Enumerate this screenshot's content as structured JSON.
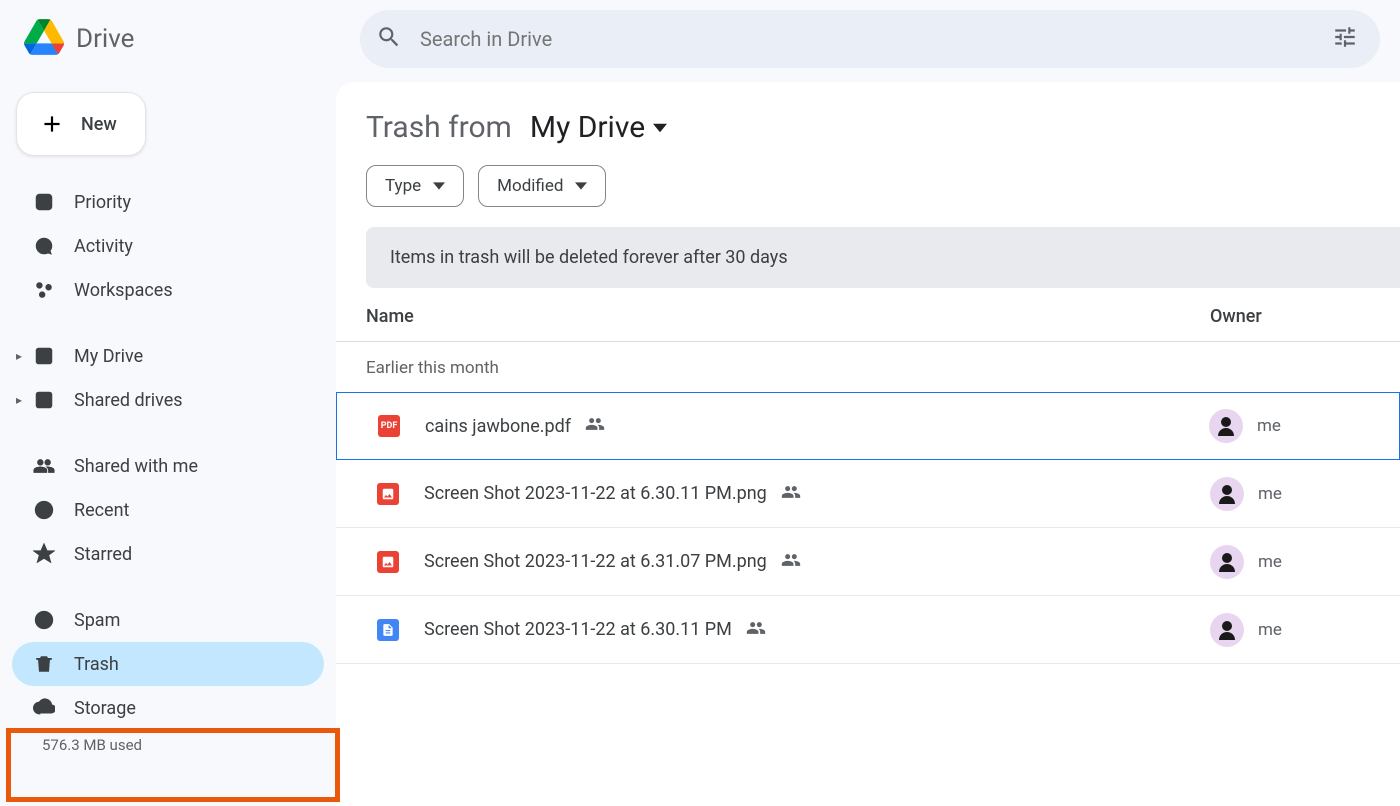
{
  "brand": {
    "name": "Drive"
  },
  "search": {
    "placeholder": "Search in Drive"
  },
  "newButton": {
    "label": "New"
  },
  "sidebar": {
    "group1": [
      {
        "icon": "priority-icon",
        "label": "Priority"
      },
      {
        "icon": "activity-icon",
        "label": "Activity"
      },
      {
        "icon": "workspaces-icon",
        "label": "Workspaces"
      }
    ],
    "group2": [
      {
        "icon": "mydrive-icon",
        "label": "My Drive",
        "expandable": true
      },
      {
        "icon": "shared-drives-icon",
        "label": "Shared drives",
        "expandable": true
      }
    ],
    "group3": [
      {
        "icon": "shared-with-me-icon",
        "label": "Shared with me"
      },
      {
        "icon": "recent-icon",
        "label": "Recent"
      },
      {
        "icon": "starred-icon",
        "label": "Starred"
      }
    ],
    "group4": [
      {
        "icon": "spam-icon",
        "label": "Spam"
      },
      {
        "icon": "trash-icon",
        "label": "Trash",
        "selected": true
      },
      {
        "icon": "storage-icon",
        "label": "Storage"
      }
    ],
    "storageUsed": "576.3 MB used"
  },
  "main": {
    "titlePrefix": "Trash from",
    "titleScope": "My Drive",
    "chips": [
      {
        "label": "Type"
      },
      {
        "label": "Modified"
      }
    ],
    "banner": "Items in trash will be deleted forever after 30 days",
    "columns": {
      "name": "Name",
      "owner": "Owner"
    },
    "sectionLabel": "Earlier this month",
    "files": [
      {
        "type": "pdf",
        "name": "cains jawbone.pdf",
        "shared": true,
        "owner": "me",
        "selected": true
      },
      {
        "type": "image",
        "name": "Screen Shot 2023-11-22 at 6.30.11 PM.png",
        "shared": true,
        "owner": "me"
      },
      {
        "type": "image",
        "name": "Screen Shot 2023-11-22 at 6.31.07 PM.png",
        "shared": true,
        "owner": "me"
      },
      {
        "type": "doc",
        "name": "Screen Shot 2023-11-22 at 6.30.11 PM",
        "shared": true,
        "owner": "me"
      }
    ]
  }
}
